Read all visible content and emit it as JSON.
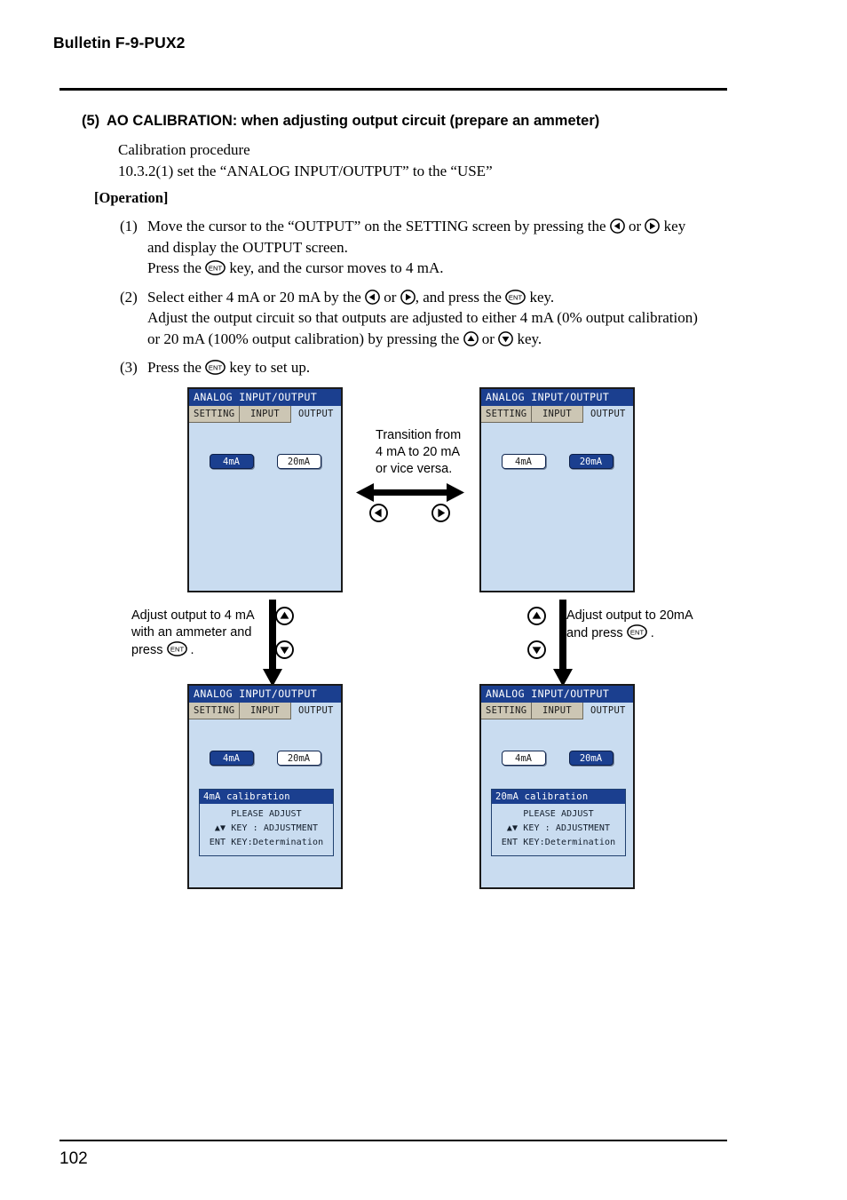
{
  "page": {
    "running_head": "Bulletin F-9-PUX2",
    "page_number": "102"
  },
  "section": {
    "number": "(5)",
    "title": "AO CALIBRATION: when adjusting output circuit (prepare an ammeter)",
    "procedure_line_1": "Calibration procedure",
    "procedure_line_2": "10.3.2(1) set the “ANALOG INPUT/OUTPUT” to the “USE”",
    "operation_label": "[Operation]"
  },
  "steps": [
    {
      "marker": "(1)",
      "lines": [
        "Move the cursor to the “OUTPUT” on the SETTING screen by pressing the ◀ or ▶ key",
        "and display the OUTPUT screen.",
        "Press the ENT key, and the cursor moves to 4 mA."
      ],
      "line1_a": "Move the cursor to the “OUTPUT” on the SETTING screen by pressing the ",
      "line1_b": " or ",
      "line1_c": " key",
      "line2": "and display the OUTPUT screen.",
      "line3_a": "Press the ",
      "line3_b": " key, and the cursor moves to 4 mA."
    },
    {
      "marker": "(2)",
      "line1_a": "Select either 4 mA or 20 mA by the ",
      "line1_b": " or ",
      "line1_c": ", and press the ",
      "line1_d": " key.",
      "line2": "Adjust the output circuit so that outputs are adjusted to either 4 mA (0% output calibration)",
      "line3_a": "or 20 mA (100% output calibration) by pressing the ",
      "line3_b": " or ",
      "line3_c": " key."
    },
    {
      "marker": "(3)",
      "line1_a": "Press the ",
      "line1_b": " key to set up."
    }
  ],
  "lcd": {
    "title": "ANALOG INPUT/OUTPUT",
    "tabs": [
      "SETTING",
      "INPUT",
      "OUTPUT"
    ],
    "active_tab": "OUTPUT",
    "buttons": {
      "ma4": "4mA",
      "ma20": "20mA"
    },
    "dialog": {
      "title_4ma": "4mA calibration",
      "title_20ma": "20mA calibration",
      "line1": "PLEASE ADJUST",
      "line2": "▲▼ KEY : ADJUSTMENT",
      "line3": "ENT KEY:Determination"
    }
  },
  "screens": [
    {
      "id": "screen-top-left",
      "selected": "4mA",
      "dialog": false
    },
    {
      "id": "screen-top-right",
      "selected": "20mA",
      "dialog": false
    },
    {
      "id": "screen-bottom-left",
      "selected": "4mA",
      "dialog": true,
      "dialog_title": "4mA calibration"
    },
    {
      "id": "screen-bottom-right",
      "selected": "20mA",
      "dialog": true,
      "dialog_title": "20mA calibration"
    }
  ],
  "annotations": {
    "transition": {
      "line1": "Transition from",
      "line2": "4 mA to 20 mA",
      "line3": "or vice versa."
    },
    "left_adjust": {
      "line1": "Adjust output to 4 mA",
      "line2": "with an ammeter and",
      "line3_a": "press ",
      "line3_b": " ."
    },
    "right_adjust": {
      "line1_a": "Adjust output to 20mA",
      "line2_a": "and press ",
      "line2_b": " ."
    }
  },
  "icons": {
    "left_key": "left-arrow-key",
    "right_key": "right-arrow-key",
    "up_key": "up-arrow-key",
    "down_key": "down-arrow-key",
    "ent_key": "ENT"
  },
  "colors": {
    "lcd_background": "#c9dcf0",
    "lcd_titlebar": "#1b3f8f",
    "tab_inactive": "#ccc6b4",
    "selected_button": "#1b3f8f",
    "text": "#000000"
  }
}
